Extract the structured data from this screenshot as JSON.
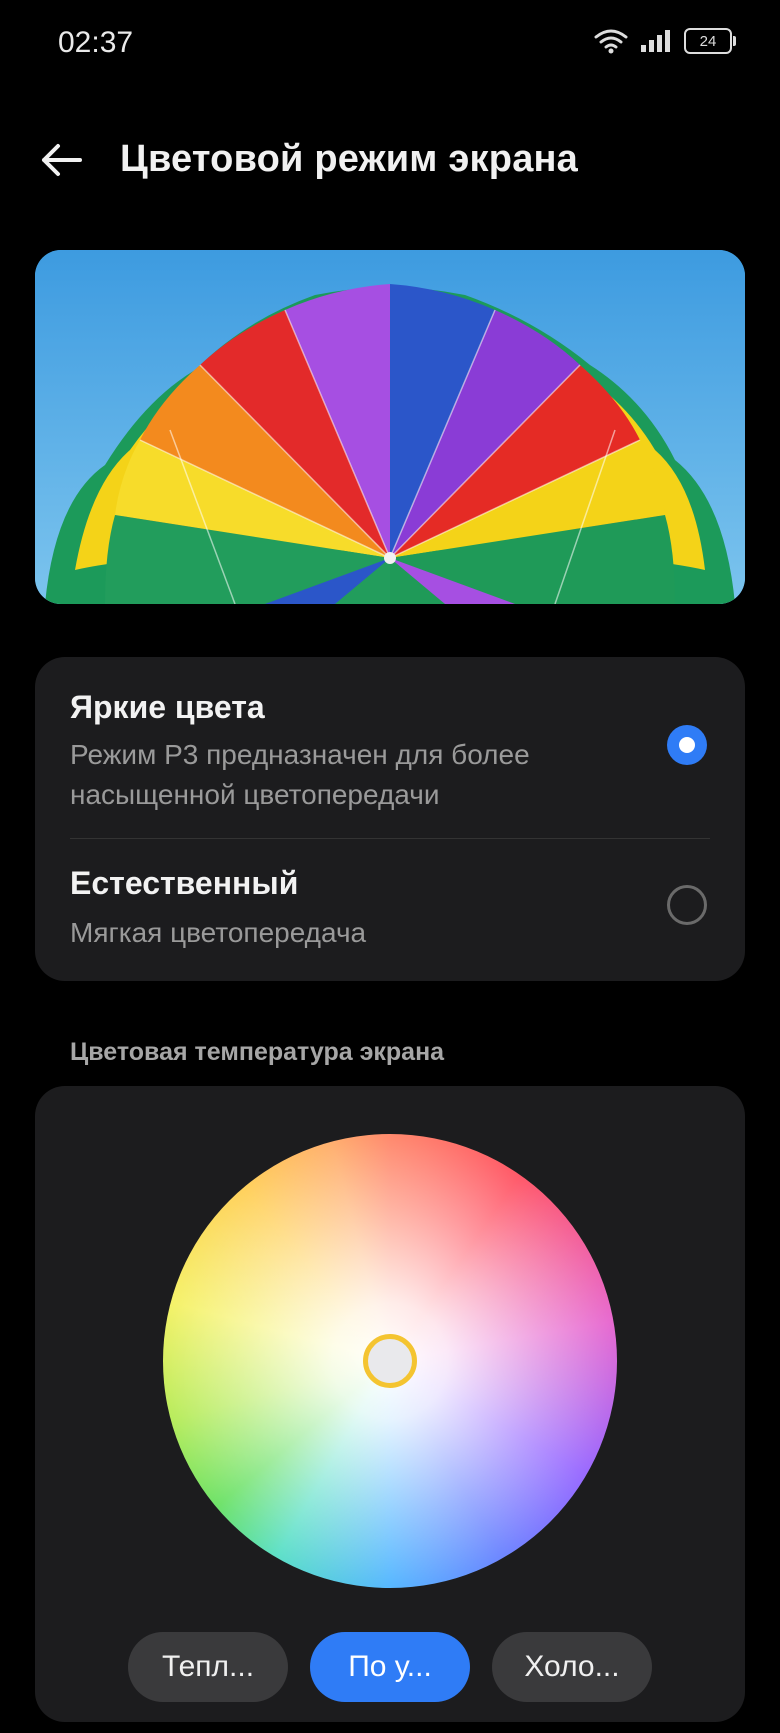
{
  "status_bar": {
    "time": "02:37",
    "battery_level": "24",
    "icons": [
      "wifi-icon",
      "signal-icon",
      "battery-icon"
    ]
  },
  "header": {
    "title": "Цветовой режим экрана",
    "back_icon": "arrow-left-icon"
  },
  "preview": {
    "image": "parachute-canopy-photo"
  },
  "modes": [
    {
      "title": "Яркие цвета",
      "description": "Режим P3 предназначен для более насыщенной цветопередачи",
      "selected": true
    },
    {
      "title": "Естественный",
      "description": "Мягкая цветопередача",
      "selected": false
    }
  ],
  "temperature": {
    "section_label": "Цветовая температура экрана",
    "buttons": [
      {
        "label": "Тепл...",
        "active": false
      },
      {
        "label": "По у...",
        "active": true
      },
      {
        "label": "Холо...",
        "active": false
      }
    ]
  },
  "colors": {
    "accent": "#2f7cf6",
    "card_background": "#1c1c1e",
    "handle_ring": "#f4c430"
  }
}
